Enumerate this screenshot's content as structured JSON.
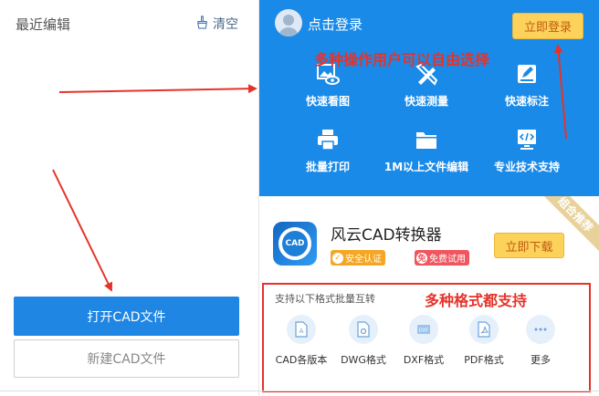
{
  "left": {
    "recent_title": "最近编辑",
    "clear_label": "清空",
    "open_button": "打开CAD文件",
    "new_button": "新建CAD文件"
  },
  "header": {
    "login_text": "点击登录",
    "login_button": "立即登录"
  },
  "features": [
    {
      "label": "快速看图",
      "icon": "image-eye-icon"
    },
    {
      "label": "快速测量",
      "icon": "ruler-pencil-icon"
    },
    {
      "label": "快速标注",
      "icon": "annotate-icon"
    },
    {
      "label": "批量打印",
      "icon": "printer-icon"
    },
    {
      "label": "1M以上文件编辑",
      "icon": "folder-icon"
    },
    {
      "label": "专业技术支持",
      "icon": "code-doc-icon"
    }
  ],
  "promo": {
    "app_name": "风云CAD转换器",
    "app_icon_text": "CAD",
    "badge_safe": "安全认证",
    "badge_free": "免费试用",
    "download_button": "立即下载",
    "ribbon": "组合推荐"
  },
  "formats": {
    "label": "支持以下格式批量互转",
    "items": [
      {
        "label": "CAD各版本",
        "icon": "cad-doc-icon"
      },
      {
        "label": "DWG格式",
        "icon": "dwg-doc-icon"
      },
      {
        "label": "DXF格式",
        "icon": "dxf-doc-icon"
      },
      {
        "label": "PDF格式",
        "icon": "pdf-doc-icon"
      },
      {
        "label": "更多",
        "icon": "more-dots-icon"
      }
    ]
  },
  "annotations": {
    "top": "多种操作用户可以自由选择",
    "formats": "多种格式都支持"
  },
  "colors": {
    "primary_blue": "#1a8ae8",
    "button_blue": "#1f86e4",
    "accent_yellow": "#fcd25a",
    "annotation_red": "#e5332a"
  }
}
